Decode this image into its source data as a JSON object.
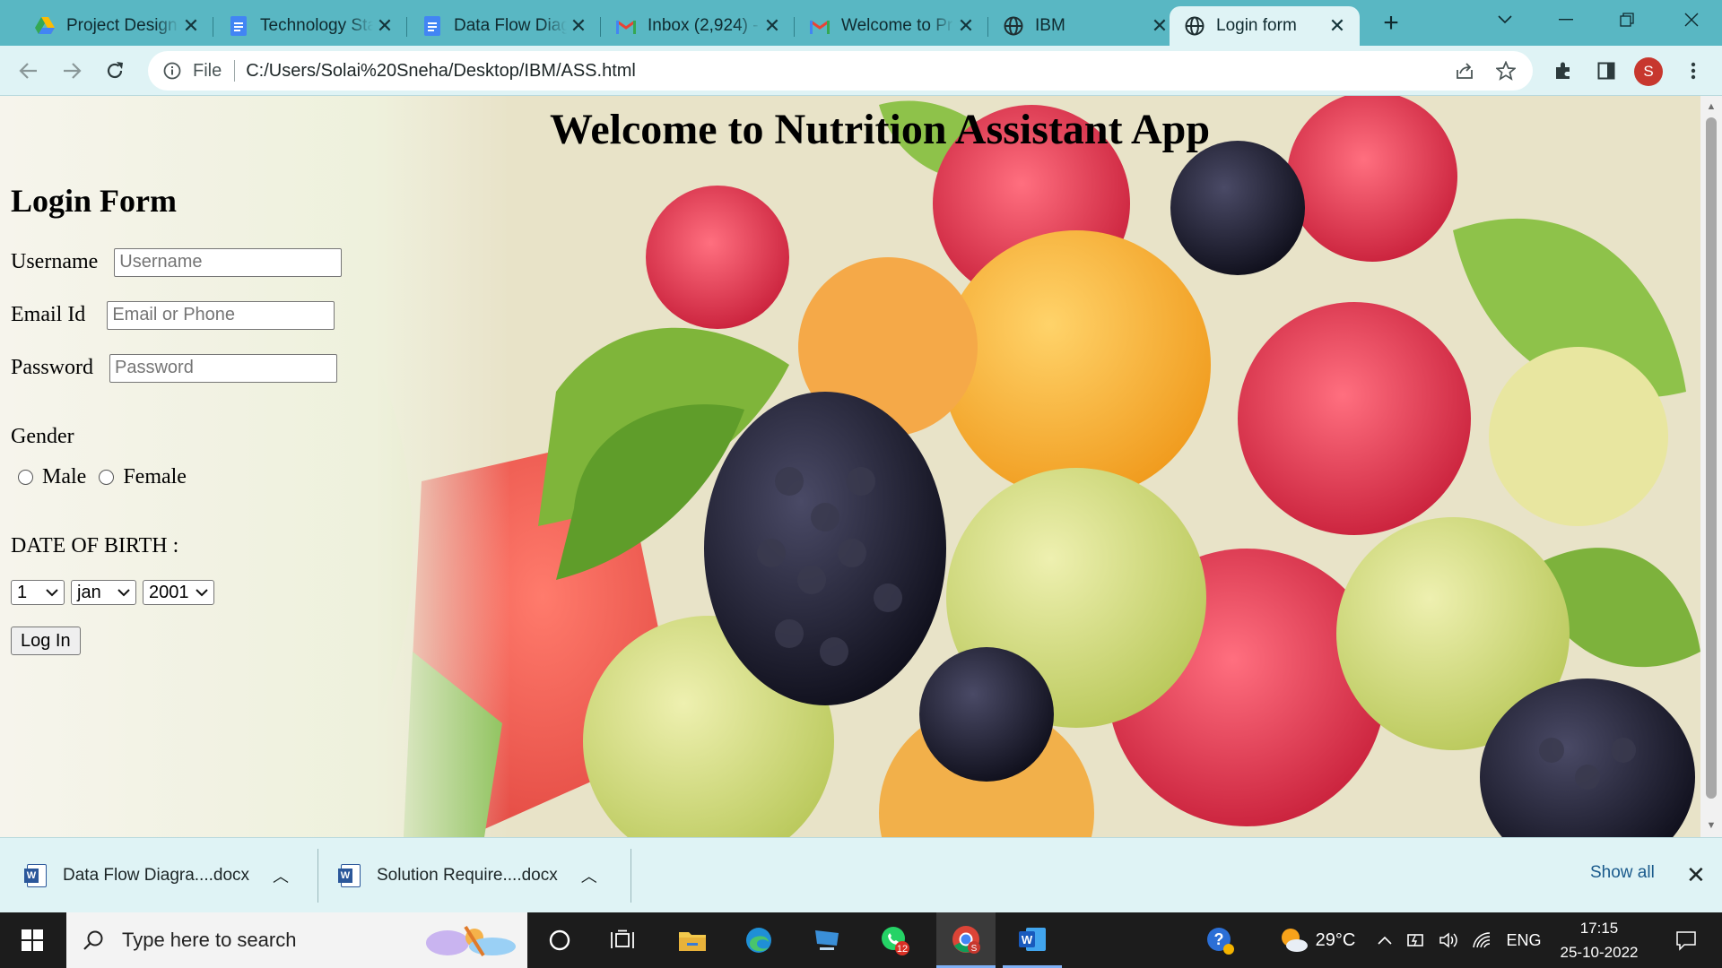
{
  "browser": {
    "tabs": [
      {
        "title": "Project Design",
        "icon": "google-drive-icon"
      },
      {
        "title": "Technology Sta",
        "icon": "google-docs-icon"
      },
      {
        "title": "Data Flow Diag",
        "icon": "google-docs-icon"
      },
      {
        "title": "Inbox (2,924) -",
        "icon": "gmail-icon"
      },
      {
        "title": "Welcome to Pr",
        "icon": "gmail-icon"
      },
      {
        "title": "IBM",
        "icon": "globe-icon"
      },
      {
        "title": "Login form",
        "icon": "globe-icon",
        "active": true
      }
    ],
    "address_prefix": "File",
    "url": "C:/Users/Solai%20Sneha/Desktop/IBM/ASS.html",
    "profile_initial": "S"
  },
  "page": {
    "title": "Welcome to Nutrition Assistant App",
    "form_heading": "Login Form",
    "username": {
      "label": "Username",
      "placeholder": "Username"
    },
    "email": {
      "label": "Email Id",
      "placeholder": "Email or Phone"
    },
    "password": {
      "label": "Password",
      "placeholder": "Password"
    },
    "gender": {
      "label": "Gender",
      "options": [
        "Male",
        "Female"
      ]
    },
    "dob": {
      "label": "DATE OF BIRTH :",
      "day": "1",
      "month": "jan",
      "year": "2001"
    },
    "submit_label": "Log In"
  },
  "downloads": {
    "items": [
      "Data Flow Diagra....docx",
      "Solution Require....docx"
    ],
    "show_all": "Show all"
  },
  "taskbar": {
    "search_placeholder": "Type here to search",
    "whatsapp_badge": "12",
    "temperature": "29°C",
    "language": "ENG",
    "time": "17:15",
    "date": "25-10-2022"
  },
  "colors": {
    "tabstrip": "#59b7c3",
    "toolbar": "#dff3f5",
    "taskbar": "#1c1c1c",
    "avatar": "#c7372e"
  }
}
